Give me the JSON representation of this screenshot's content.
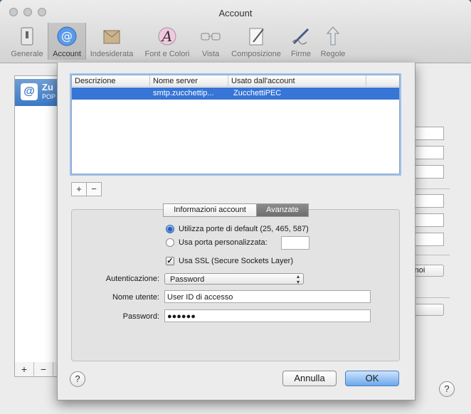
{
  "window": {
    "title": "Account"
  },
  "toolbar": {
    "items": [
      {
        "label": "Generale",
        "icon": "switch-icon"
      },
      {
        "label": "Account",
        "icon": "at-sign-icon",
        "selected": true
      },
      {
        "label": "Indesiderata",
        "icon": "junk-mail-icon"
      },
      {
        "label": "Font e Colori",
        "icon": "fonts-colors-icon"
      },
      {
        "label": "Vista",
        "icon": "glasses-icon"
      },
      {
        "label": "Composizione",
        "icon": "compose-pencil-icon"
      },
      {
        "label": "Firme",
        "icon": "signature-pen-icon"
      },
      {
        "label": "Regole",
        "icon": "rules-arrows-icon"
      }
    ]
  },
  "accounts": {
    "selected": {
      "name": "Zu",
      "type": "POP"
    },
    "add_label": "+",
    "remove_label": "−"
  },
  "sheet": {
    "table": {
      "headers": [
        "Descrizione",
        "Nome server",
        "Usato dall'account"
      ],
      "rows": [
        {
          "descrizione": "",
          "server": "smtp.zucchettip...",
          "account": "ZucchettiPEC",
          "selected": true
        }
      ]
    },
    "add_label": "+",
    "remove_label": "−",
    "tabs": [
      "Informazioni account",
      "Avanzate"
    ],
    "active_tab": "Avanzate",
    "port": {
      "default_label": "Utilizza porte di default (25, 465, 587)",
      "custom_label": "Usa porta personalizzata:",
      "custom_value": "",
      "selected": "default"
    },
    "ssl": {
      "label": "Usa SSL (Secure Sockets Layer)",
      "checked": true
    },
    "auth": {
      "label": "Autenticazione:",
      "value": "Password"
    },
    "username": {
      "label": "Nome utente:",
      "value": "User ID di accesso"
    },
    "password": {
      "label": "Password:",
      "value": "●●●●●●"
    },
    "cancel_label": "Annulla",
    "ok_label": "OK",
    "help_label": "?"
  },
  "background": {
    "popup1_value": "(noi",
    "help_label": "?"
  },
  "colors": {
    "accent": "#3775d6",
    "default_button": "#6aa7ef"
  }
}
